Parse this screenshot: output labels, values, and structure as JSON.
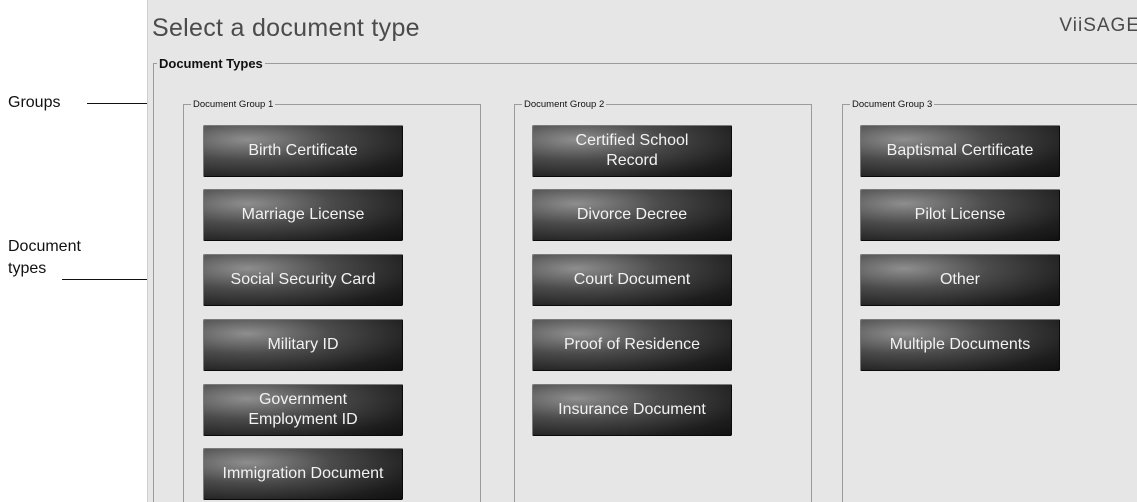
{
  "annotations": {
    "groups": "Groups",
    "document_types": "Document\ntypes"
  },
  "header": {
    "title": "Select a document type",
    "brand": "ViiSAGE"
  },
  "section_label": "Document Types",
  "groups": [
    {
      "label": "Document Group 1",
      "buttons": [
        "Birth Certificate",
        "Marriage License",
        "Social Security Card",
        "Military ID",
        "Government\nEmployment ID",
        "Immigration Document"
      ]
    },
    {
      "label": "Document Group 2",
      "buttons": [
        "Certified School\nRecord",
        "Divorce Decree",
        "Court Document",
        "Proof of Residence",
        "Insurance Document"
      ]
    },
    {
      "label": "Document Group 3",
      "buttons": [
        "Baptismal Certificate",
        "Pilot License",
        "Other",
        "Multiple Documents"
      ]
    }
  ]
}
